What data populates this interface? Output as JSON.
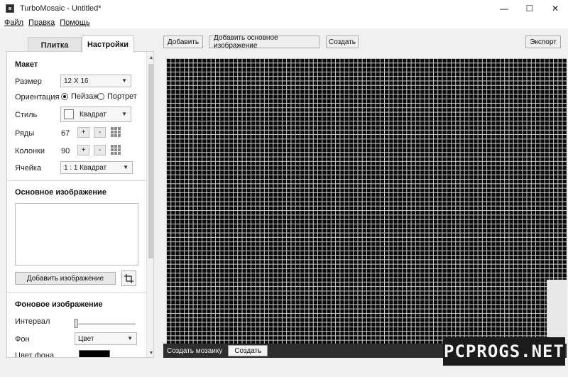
{
  "window": {
    "title": "TurboMosaic - Untitled*",
    "controls": {
      "minimize": "—",
      "maximize": "☐",
      "close": "✕"
    }
  },
  "menu": [
    "Файл",
    "Правка",
    "Помощь"
  ],
  "tabs": {
    "tile": "Плитка",
    "settings": "Настройки"
  },
  "layout": {
    "title": "Макет",
    "size_label": "Размер",
    "size_value": "12 X 16",
    "orientation_label": "Ориентация",
    "landscape": "Пейзаж",
    "portrait": "Портрет",
    "orientation_selected": "landscape",
    "style_label": "Стиль",
    "style_value": "Квадрат",
    "rows_label": "Ряды",
    "rows_value": "67",
    "cols_label": "Колонки",
    "cols_value": "90",
    "plus": "+",
    "minus": "-",
    "cell_label": "Ячейка",
    "cell_value": "1 : 1 Квадрат"
  },
  "main_image": {
    "title": "Основное изображение",
    "add_button": "Добавить изображение"
  },
  "background": {
    "title": "Фоновое изображение",
    "interval_label": "Интервал",
    "interval_value": 0,
    "bg_label": "Фон",
    "bg_value": "Цвет",
    "bg_color_label": "Цвет фона",
    "bg_color": "#000000"
  },
  "toolbar": {
    "add": "Добавить",
    "add_main": "Добавить основное изображение",
    "create": "Создать",
    "export": "Экспорт"
  },
  "bottom": {
    "label": "Создать мозаику",
    "button": "Создать"
  },
  "watermark": "PCPROGS.NET"
}
